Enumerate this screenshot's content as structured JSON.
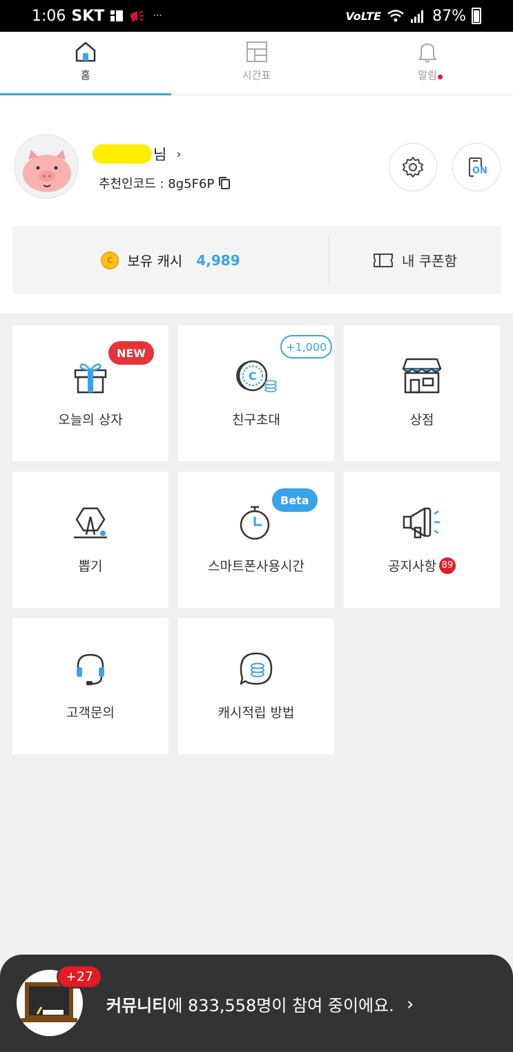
{
  "status_bar": {
    "time": "1:06",
    "carrier": "SKT",
    "network": "VoLTE",
    "battery": "87%"
  },
  "tabs": [
    {
      "label": "홈",
      "icon": "home-icon",
      "active": true
    },
    {
      "label": "시간표",
      "icon": "layout-icon",
      "active": false
    },
    {
      "label": "알림",
      "icon": "bell-icon",
      "active": false
    }
  ],
  "profile": {
    "name_suffix": "님",
    "name_arrow": "›",
    "referral_code": "추천인코드 : 8g5F6P",
    "settings_icon": "gear-icon",
    "phone_mode_label": "ON"
  },
  "cash": {
    "label": "보유 캐시",
    "value": "4,989",
    "coin_symbol": "C",
    "coupon_label": "내 쿠폰함"
  },
  "menu": [
    {
      "label": "오늘의 상자",
      "icon": "gift-icon",
      "badge": "NEW"
    },
    {
      "label": "친구초대",
      "icon": "coin-icon",
      "badge": "+1,000"
    },
    {
      "label": "상점",
      "icon": "store-icon"
    },
    {
      "label": "뽑기",
      "icon": "lottery-icon"
    },
    {
      "label": "스마트폰사용시간",
      "icon": "timer-icon",
      "badge": "Beta"
    },
    {
      "label": "공지사항",
      "icon": "megaphone-icon",
      "count": "89"
    },
    {
      "label": "고객문의",
      "icon": "headset-icon"
    },
    {
      "label": "캐시적립 방법",
      "icon": "chat-coin-icon"
    }
  ],
  "community": {
    "new_count": "+27",
    "bold": "커뮤니티",
    "text": "에 833,558명이 참여 중이에요.",
    "arrow": "›"
  },
  "colors": {
    "accent": "#3aa2e8",
    "badge_red": "#e63238",
    "banner": "#333333"
  }
}
